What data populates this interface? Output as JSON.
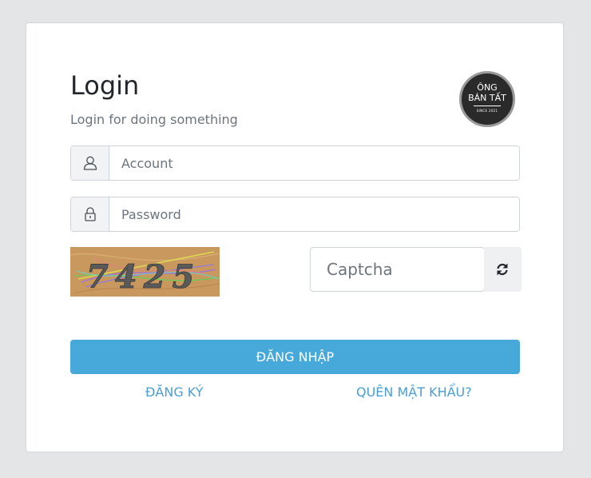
{
  "header": {
    "title": "Login",
    "subtitle": "Login for doing something"
  },
  "logo": {
    "line1": "ÔNG",
    "line2": "BÁN TẤT",
    "line3": "SINCE 2021"
  },
  "form": {
    "account_placeholder": "Account",
    "password_placeholder": "Password",
    "captcha_placeholder": "Captcha",
    "captcha_text": "7425",
    "login_label": "ĐĂNG NHẬP",
    "register_label": "ĐĂNG KÝ",
    "forgot_label": "QUÊN MẬT KHẨU?"
  },
  "icons": {
    "account": "user-icon",
    "password": "lock-icon",
    "refresh": "refresh-icon"
  },
  "colors": {
    "primary": "#47a9da",
    "link": "#4a9fd9",
    "background": "#e4e5e7"
  }
}
